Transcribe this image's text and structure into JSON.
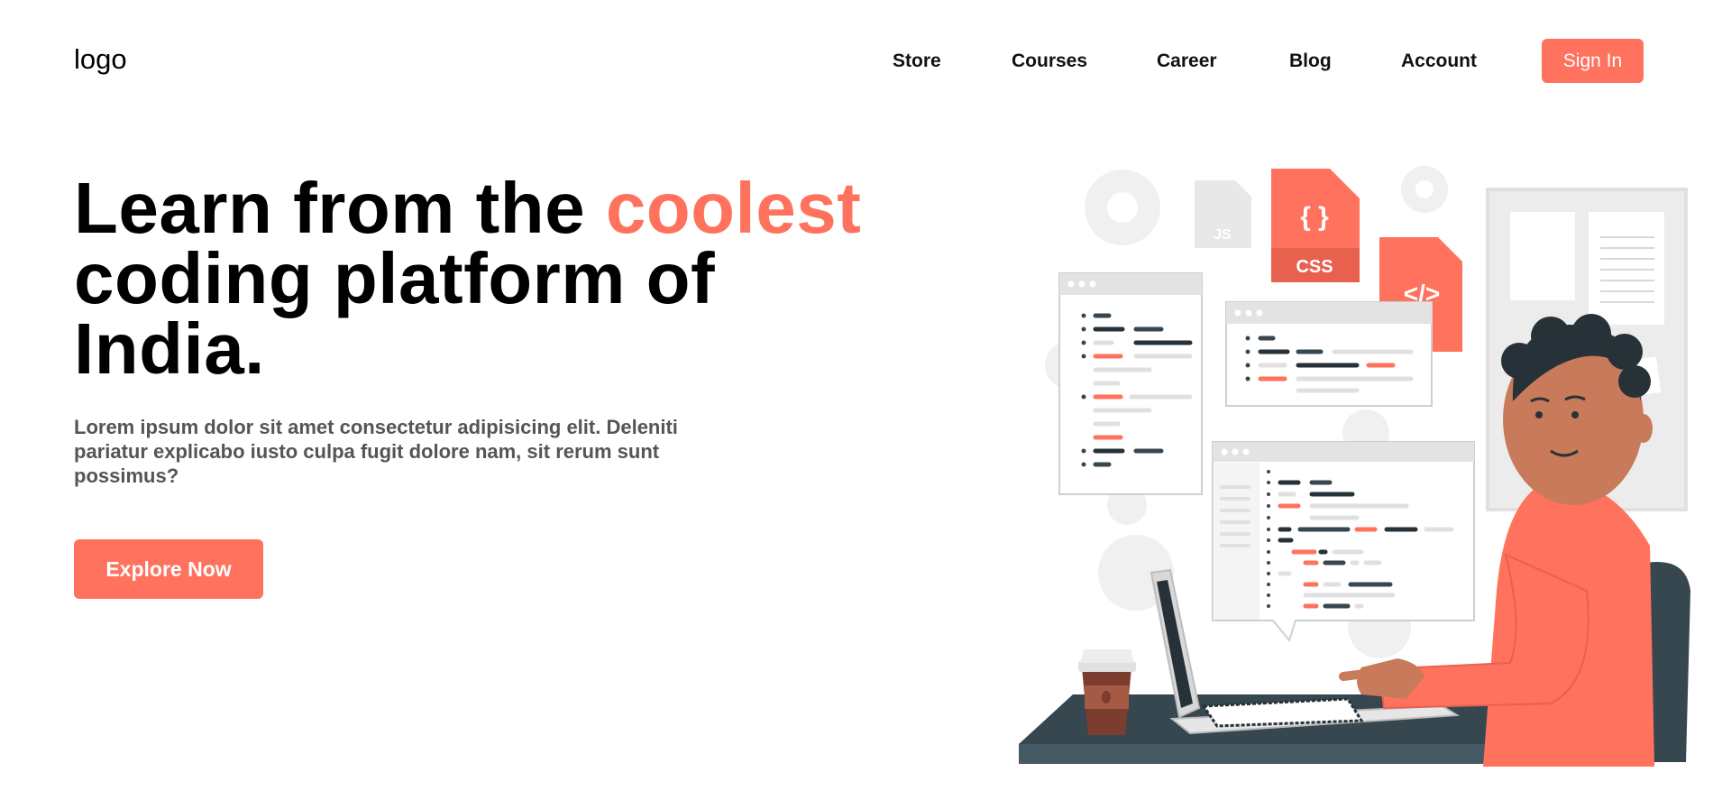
{
  "nav": {
    "logo": "logo",
    "items": [
      {
        "label": "Store"
      },
      {
        "label": "Courses"
      },
      {
        "label": "Career"
      },
      {
        "label": "Blog"
      },
      {
        "label": "Account"
      }
    ],
    "signin_label": "Sign In"
  },
  "hero": {
    "title_before": "Learn from the ",
    "title_accent": "coolest",
    "title_after": " coding platform of India.",
    "description": "Lorem ipsum dolor sit amet consectetur adipisicing elit. Deleniti pariatur explicabo iusto culpa fugit dolore nam, sit rerum sunt possimus?",
    "cta_label": "Explore Now"
  },
  "illustration": {
    "file_badges": [
      "{ }",
      "CSS",
      "</>",
      "JS"
    ],
    "subject": "person coding on a laptop"
  },
  "colors": {
    "accent": "#ff725e",
    "dark_teal": "#37474f",
    "text_muted": "#555555"
  }
}
